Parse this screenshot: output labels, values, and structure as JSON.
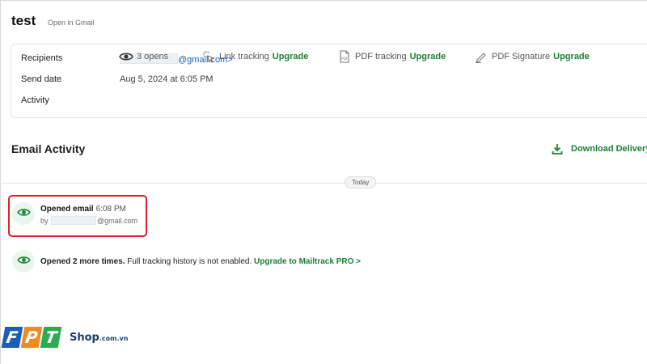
{
  "header": {
    "subject": "test",
    "open_in_gmail": "Open in Gmail"
  },
  "details": {
    "recipients_label": "Recipients",
    "recipient_suffix": "@gmail.com>",
    "send_date_label": "Send date",
    "send_date_value": "Aug 5, 2024 at 6:05 PM",
    "activity_label": "Activity",
    "opens": "3 opens",
    "link_tracking": "Link tracking",
    "pdf_tracking": "PDF tracking",
    "pdf_signature": "PDF Signature",
    "upgrade": "Upgrade"
  },
  "activity": {
    "title": "Email Activity",
    "download_label": "Download Delivery",
    "today_chip": "Today",
    "event": {
      "title": "Opened email",
      "time": "6:08 PM",
      "by_prefix": "by",
      "by_suffix": "@gmail.com"
    },
    "more": {
      "text": "Opened 2 more times.",
      "note": "Full tracking history is not enabled.",
      "link": "Upgrade to Mailtrack PRO >"
    }
  },
  "branding": {
    "tiles": [
      "F",
      "P",
      "T"
    ],
    "shop": "Shop",
    "domain": ".com.vn"
  },
  "colors": {
    "accent": "#188038",
    "highlight": "#e01f2a",
    "eye_badge": "#eaf5ee"
  },
  "icons": [
    "eye-icon",
    "link-click-icon",
    "pdf-file-icon",
    "signature-pen-icon",
    "download-icon"
  ]
}
